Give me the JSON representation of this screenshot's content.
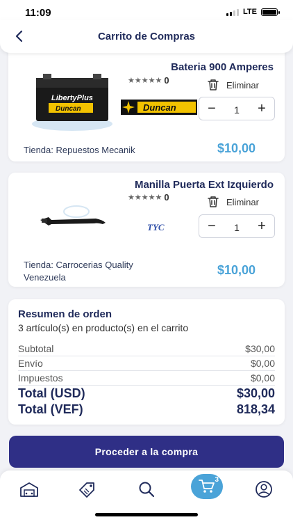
{
  "status_bar": {
    "time": "11:09",
    "network": "LTE"
  },
  "header": {
    "title": "Carrito de Compras"
  },
  "cart_items": [
    {
      "name": "Bateria 900 Amperes",
      "stars": "★★★★★",
      "rating_count": "0",
      "remove_label": "Eliminar",
      "quantity": "1",
      "store": "Tienda: Repuestos Mecanik",
      "price": "$10,00",
      "product_logo_text": "LibertyPlus",
      "brand_logo_text": "Duncan"
    },
    {
      "name": "Manilla Puerta Ext Izquierdo",
      "stars": "★★★★★",
      "rating_count": "0",
      "remove_label": "Eliminar",
      "quantity": "1",
      "store": "Tienda: Carrocerias Quality Venezuela",
      "price": "$10,00",
      "brand_logo_text": "TYC"
    }
  ],
  "summary": {
    "title": "Resumen de orden",
    "subtitle": "3 artículo(s) en  producto(s) en el carrito",
    "rows": [
      {
        "label": "Subtotal",
        "value": "$30,00"
      },
      {
        "label": "Envío",
        "value": "$0,00"
      },
      {
        "label": "Impuestos",
        "value": "$0,00"
      }
    ],
    "total_usd": {
      "label": "Total (USD)",
      "value": "$30,00"
    },
    "total_vef": {
      "label": "Total (VEF)",
      "value": "818,34"
    }
  },
  "cta": {
    "label": "Proceder a la compra"
  },
  "tabbar": {
    "items": [
      "garage-icon",
      "tag-icon",
      "search-icon",
      "cart-icon",
      "user-icon"
    ],
    "cart_count": "3"
  },
  "colors": {
    "navy": "#1f2a5a",
    "accent_blue": "#4aa3d8",
    "cta": "#2f2f86"
  }
}
